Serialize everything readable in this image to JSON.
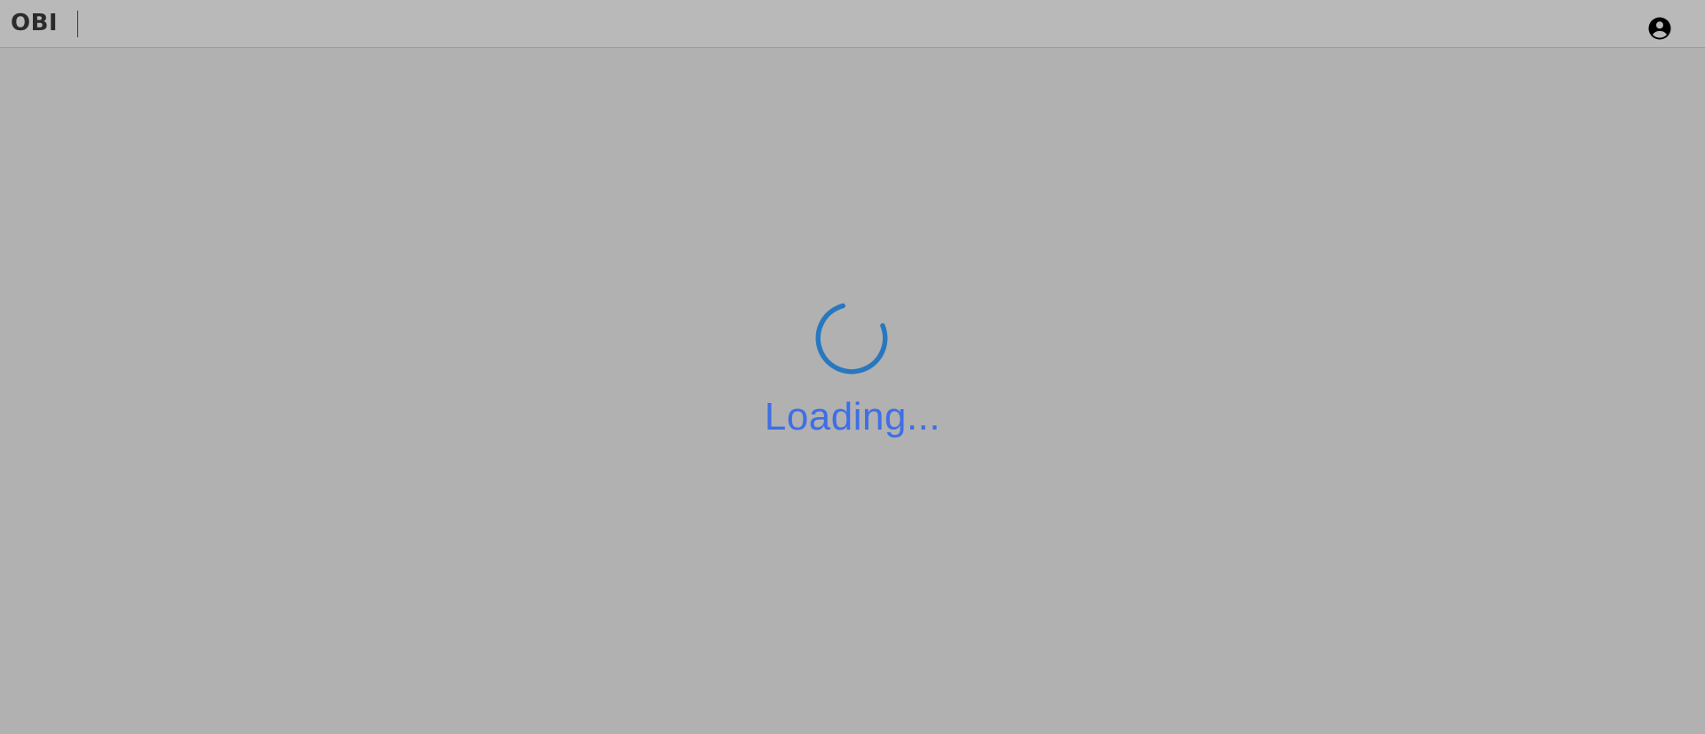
{
  "header": {
    "brand": "OBI",
    "account_icon": "account-circle-icon"
  },
  "loader": {
    "spinner_icon": "spinner-icon",
    "text": "Loading...",
    "spinner_color": "#2878c0",
    "text_color": "#3d6fe6"
  },
  "colors": {
    "overlay_background": "#b1b1b1",
    "header_background": "#b9b9b9",
    "brand_text": "#2b2b2b"
  }
}
